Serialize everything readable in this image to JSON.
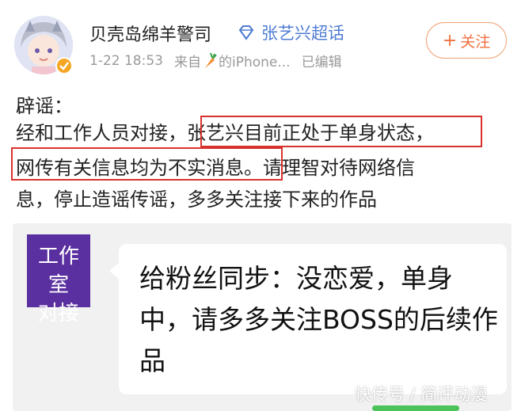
{
  "post": {
    "username": "贝壳岛绵羊警司",
    "topic": "张艺兴超话",
    "time": "1-22 18:53",
    "from_prefix": "来自",
    "from_suffix": "的iPhone...",
    "edited": "已编辑",
    "follow_label": "关注",
    "follow_plus": "+"
  },
  "content": {
    "line1": "辟谣：",
    "line2_a": "经和工作人员对接，",
    "line2_b": "张艺兴目前正处于单身状态，",
    "line3_a": "网传有关信息均为不实消息",
    "line3_b": "。请理智对待网络信",
    "line4": "息，停止造谣传谣，多多关注接下来的作品"
  },
  "chat": {
    "sender_line1": "工作室",
    "sender_line2": "对接",
    "message": "给粉丝同步：没恋爱，单身中，请多多关注BOSS的后续作品"
  },
  "watermark": "快传号 / 简评动漫",
  "colors": {
    "highlight": "#d7332c",
    "topic": "#4f7cd3",
    "follow": "#f07040",
    "studio": "#5a2fa0"
  }
}
